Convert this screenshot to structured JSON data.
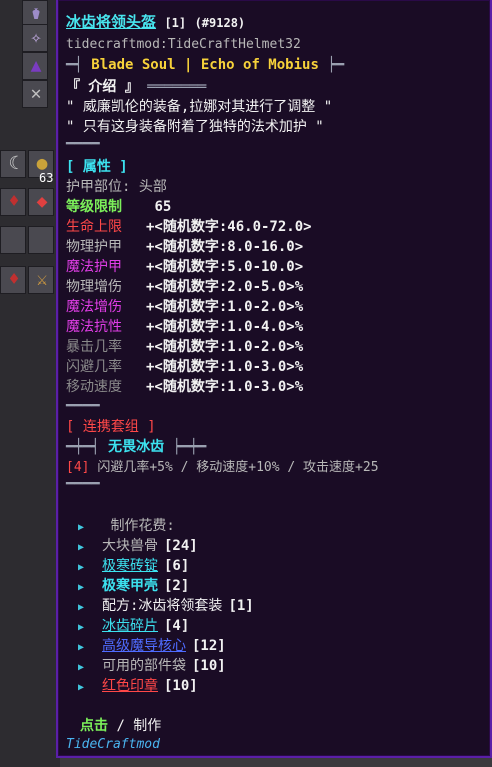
{
  "background": {
    "stack_count": "63"
  },
  "tooltip": {
    "item_name": "冰齿将领头盔",
    "tier": "[1]",
    "item_id": "(#9128)",
    "registry_name": "tidecraftmod:TideCraftHelmet32",
    "series_prefix": "━┥",
    "series_name": "Blade Soul | Echo of Mobius",
    "series_suffix": "┝━",
    "intro_header": "『 介绍 』",
    "intro_tail": "═══════",
    "intro_line1": "\" 威廉凯伦的装备,拉娜对其进行了调整 \"",
    "intro_line2": "\" 只有这身装备附着了独特的法术加护 \"",
    "divider": "━━━━",
    "attr_header": "[ 属性 ]",
    "armor_slot_label": "护甲部位:",
    "armor_slot_value": "头部",
    "level_req_label": "等级限制",
    "level_req_value": "65",
    "stats": [
      {
        "label": "生命上限",
        "value": "+<随机数字:46.0-72.0>",
        "color": "#ff4848"
      },
      {
        "label": "物理护甲",
        "value": "+<随机数字:8.0-16.0>",
        "color": "#b8b8b8"
      },
      {
        "label": "魔法护甲",
        "value": "+<随机数字:5.0-10.0>",
        "color": "#e23ee8"
      },
      {
        "label": "物理增伤",
        "value": "+<随机数字:2.0-5.0>%",
        "color": "#b8b8b8"
      },
      {
        "label": "魔法增伤",
        "value": "+<随机数字:1.0-2.0>%",
        "color": "#e23ee8"
      },
      {
        "label": "魔法抗性",
        "value": "+<随机数字:1.0-4.0>%",
        "color": "#e23ee8"
      },
      {
        "label": "暴击几率",
        "value": "+<随机数字:1.0-2.0>%",
        "color": "#8a8a8a"
      },
      {
        "label": "闪避几率",
        "value": "+<随机数字:1.0-3.0>%",
        "color": "#8a8a8a"
      },
      {
        "label": "移动速度",
        "value": "+<随机数字:1.0-3.0>%",
        "color": "#8a8a8a"
      }
    ],
    "set_header": "[ 连携套组 ]",
    "set_bar_left": "━┿━┥",
    "set_name": "无畏冰齿",
    "set_bar_right": "┝━┿━",
    "set_bonus_count": "[4]",
    "set_bonus_text": "闪避几率+5% / 移动速度+10% / 攻击速度+25",
    "craft_header": "制作花费:",
    "craft_items": [
      {
        "name": "大块兽骨",
        "count": "[24]",
        "color": "#b8b8b8"
      },
      {
        "name": "极寒砖锭",
        "count": "[6]",
        "color": "#3ce2ef"
      },
      {
        "name": "极寒甲壳",
        "count": "[2]",
        "color": "#3ce2ef"
      },
      {
        "name": "配方:冰齿将领套装",
        "count": "[1]",
        "color": "#f2f2f2"
      },
      {
        "name": "冰齿碎片",
        "count": "[4]",
        "color": "#3ce2ef"
      },
      {
        "name": "高级魔导核心",
        "count": "[12]",
        "color": "#4f6cff"
      },
      {
        "name": "可用的部件袋",
        "count": "[10]",
        "color": "#b8b8b8"
      },
      {
        "name": "红色印章",
        "count": "[10]",
        "color": "#ff4848"
      }
    ],
    "click_label": "点击",
    "craft_action": "/ 制作",
    "mod_name": "TideCraftmod"
  }
}
